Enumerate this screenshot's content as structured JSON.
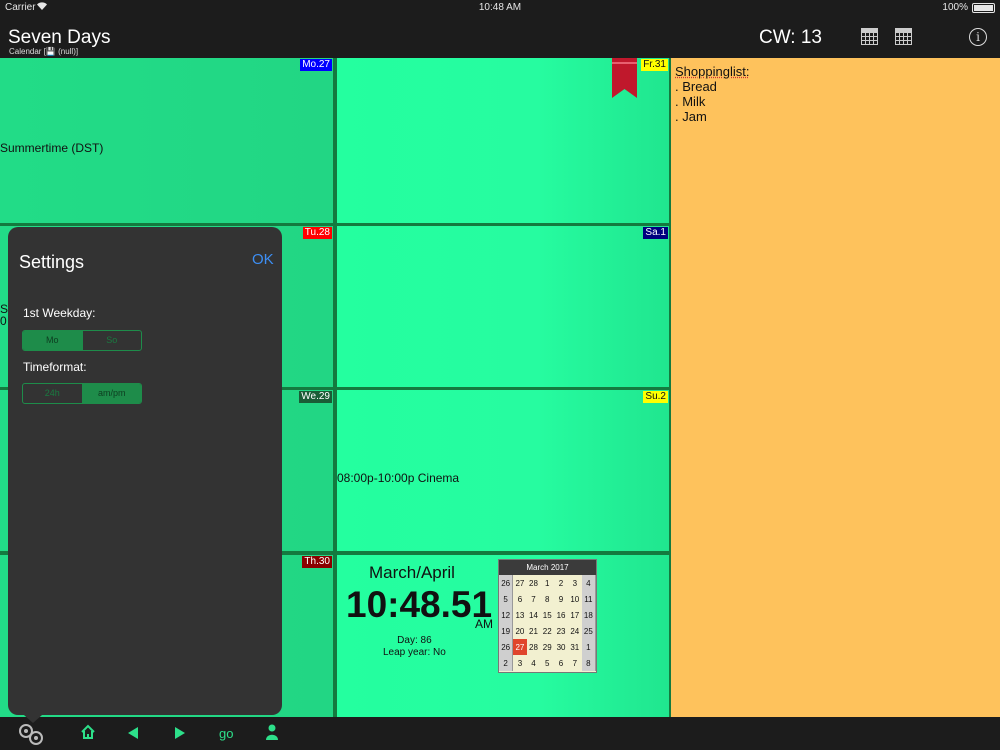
{
  "status": {
    "carrier": "Carrier",
    "time": "10:48 AM",
    "battery": "100%"
  },
  "header": {
    "title": "Seven Days",
    "subtitle": "Calendar [💾 (null)]",
    "week": "CW: 13"
  },
  "days": {
    "mo": {
      "label": "Mo.27",
      "color": "#0000ff",
      "text_color": "#ffffff",
      "entry": "Summertime (DST)"
    },
    "tu": {
      "label": "Tu.28",
      "color": "#ff0000",
      "text_color": "#ffffff"
    },
    "we": {
      "label": "We.29",
      "color": "#1a5c36",
      "text_color": "#ffffff"
    },
    "th": {
      "label": "Th.30",
      "color": "#8b0000",
      "text_color": "#ffffff"
    },
    "fr": {
      "label": "Fr.31",
      "color": "#ffff00",
      "text_color": "#111111"
    },
    "sa": {
      "label": "Sa.1",
      "color": "#00007f",
      "text_color": "#ffffff"
    },
    "su": {
      "label": "Su.2",
      "color": "#ffff00",
      "text_color": "#111111",
      "entry": "08:00p-10:00p  Cinema"
    }
  },
  "notes": {
    "heading": "Shoppinglist:",
    "items": [
      ". Bread",
      ". Milk",
      ". Jam"
    ]
  },
  "clock": {
    "month": "March/April",
    "time": "10:48.51",
    "ampm": "AM",
    "day": "Day: 86",
    "leap": "Leap year: No"
  },
  "minical": {
    "title": "March 2017",
    "today": "27",
    "rows": [
      [
        "26",
        "27",
        "28",
        "1",
        "2",
        "3",
        "4"
      ],
      [
        "5",
        "6",
        "7",
        "8",
        "9",
        "10",
        "11"
      ],
      [
        "12",
        "13",
        "14",
        "15",
        "16",
        "17",
        "18"
      ],
      [
        "19",
        "20",
        "21",
        "22",
        "23",
        "24",
        "25"
      ],
      [
        "26",
        "27",
        "28",
        "29",
        "30",
        "31",
        "1"
      ],
      [
        "2",
        "3",
        "4",
        "5",
        "6",
        "7",
        "8"
      ]
    ]
  },
  "settings": {
    "title": "Settings",
    "ok": "OK",
    "weekday_label": "1st Weekday:",
    "weekday_options": [
      "Mo",
      "So"
    ],
    "weekday_selected": "Mo",
    "timeformat_label": "Timeformat:",
    "timeformat_options": [
      "24h",
      "am/pm"
    ],
    "timeformat_selected": "am/pm"
  },
  "bottombar": {
    "go": "go"
  },
  "partial_text": {
    "mo_line": "S",
    "tu_line": "0"
  },
  "icons": [
    "wifi-icon",
    "battery-icon",
    "calendar-icon",
    "calendar-week-icon",
    "info-icon",
    "bookmark-icon",
    "settings-gears-icon",
    "home-icon",
    "previous-arrow-icon",
    "next-arrow-icon",
    "person-icon"
  ]
}
